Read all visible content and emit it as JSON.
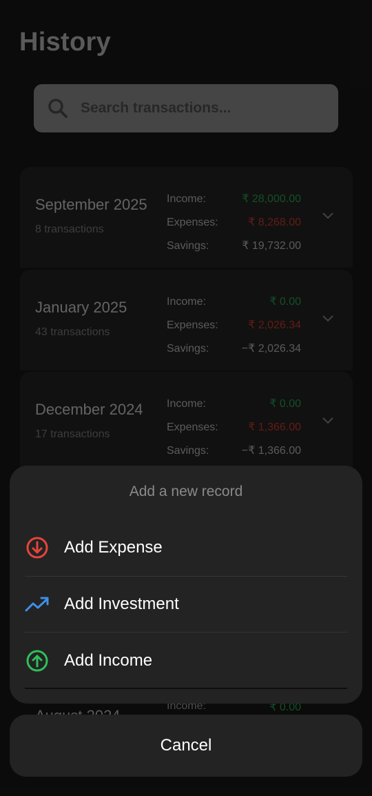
{
  "header": {
    "title": "History"
  },
  "search": {
    "placeholder": "Search transactions..."
  },
  "labels": {
    "income": "Income:",
    "expenses": "Expenses:",
    "savings": "Savings:"
  },
  "months": [
    {
      "name": "September 2025",
      "count": "8 transactions",
      "income": "₹ 28,000.00",
      "expenses": "₹ 8,268.00",
      "savings": "₹ 19,732.00"
    },
    {
      "name": "January 2025",
      "count": "43 transactions",
      "income": "₹ 0.00",
      "expenses": "₹ 2,026.34",
      "savings": "−₹ 2,026.34"
    },
    {
      "name": "December 2024",
      "count": "17 transactions",
      "income": "₹ 0.00",
      "expenses": "₹ 1,366.00",
      "savings": "−₹ 1,366.00"
    },
    {
      "name": "August 2024",
      "income": "₹ 0.00"
    }
  ],
  "sheet": {
    "title": "Add a new record",
    "options": [
      {
        "label": "Add Expense",
        "icon": "arrow-down-circle-icon",
        "color": "#e5453b"
      },
      {
        "label": "Add Investment",
        "icon": "trending-up-icon",
        "color": "#3f8fe8"
      },
      {
        "label": "Add Income",
        "icon": "arrow-up-circle-icon",
        "color": "#2fbf5a"
      }
    ],
    "cancel": "Cancel"
  },
  "colors": {
    "income": "#2fbf5a",
    "expense": "#e5453b",
    "background": "#121212"
  }
}
